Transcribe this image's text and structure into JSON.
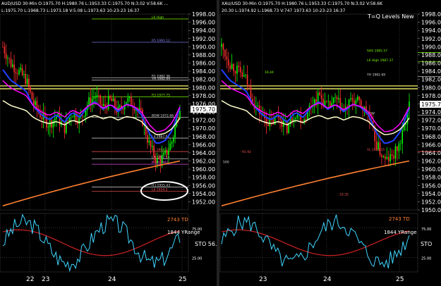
{
  "panels": [
    {
      "id": "left",
      "header": "AUD/USD 30-Min O:1975.70 H:1980.76 L:1953.33 C:1975.70 N:3.02 V:58.6K ...",
      "header2": "L:1975.70 L:1968.73 L:1973.18 V:5.08 L:1973.63 10-23-23 16:37",
      "last_price_tag": "1975.70",
      "level_labels": [
        {
          "text": "L6 High",
          "price": 1996.8,
          "color": "#7CFC00"
        },
        {
          "text": "R5 1991.12",
          "price": 1991.1,
          "color": "#8888ff"
        },
        {
          "text": "R1 1982.36",
          "price": 1982.4,
          "color": "#dddddd"
        },
        {
          "text": "YH 1982.69",
          "price": 1981.8,
          "color": "#dddddd"
        },
        {
          "text": "R3 1977.75",
          "price": 1977.7,
          "color": "#7CFC00"
        },
        {
          "text": "BOW 1972.68",
          "price": 1972.7,
          "color": "#dddddd"
        },
        {
          "text": "L3 1967.61",
          "price": 1967.6,
          "color": "#dddddd"
        },
        {
          "text": "YL 1964.25",
          "price": 1964.3,
          "color": "#ff5555"
        },
        {
          "text": "L4 1962.54",
          "price": 1962.5,
          "color": "#dddddd"
        },
        {
          "text": "M alt 1961",
          "price": 1961.2,
          "color": "#ff55ff"
        },
        {
          "text": "H.J 1955.43",
          "price": 1955.6,
          "color": "#dddddd"
        },
        {
          "text": "L6 1954.5",
          "price": 1954.6,
          "color": "#ff5555"
        }
      ],
      "stoch_labels": {
        "td": "2743 TD",
        "yrange": "1844 YRange",
        "sto": "STO 56."
      }
    },
    {
      "id": "right",
      "header": "XAU/USD 30-Min O:1975.70 H:1980.76 L:1953.33 C:1975.70 N:3.02 V:58.6K",
      "header2": "20.30 L:1974.92 L:1968.73 V:747 1973.63 10-23-23 16:37",
      "title": "T=Q Levels New",
      "last_price_tag": "1975.7",
      "level_labels": [
        {
          "text": "SHS 1985.57",
          "price": 1988.6,
          "color": "#7CFC00"
        },
        {
          "text": "L6 High 1987.37",
          "price": 1986.3,
          "color": "#7CFC00"
        },
        {
          "text": "YH 1982.69",
          "price": 1982.7,
          "color": "#dddddd"
        },
        {
          "text": "BOW",
          "price": 1973.2,
          "color": "#dddddd"
        },
        {
          "text": "YL 1964.25",
          "price": 1964.3,
          "color": "#ff5555"
        }
      ],
      "side_labels": [
        {
          "text": "16.44",
          "price": 1983.5,
          "color": "#7CFC00"
        },
        {
          "text": "- 91.92",
          "price": 1964.0,
          "color": "#ff5555"
        },
        {
          "text": "500",
          "price": 1961.5,
          "color": "#dddddd"
        },
        {
          "text": "- 33.35",
          "price": 1953.5,
          "color": "#ff5555"
        }
      ],
      "stoch_labels": {
        "td": "2743 TD",
        "yrange": "1844 YRange",
        "sto": "STO"
      }
    }
  ],
  "price_axis_ticks": [
    "1998.00",
    "1996.00",
    "1994.00",
    "1992.00",
    "1990.00",
    "1988.00",
    "1986.00",
    "1984.00",
    "1982.00",
    "1980.00",
    "1978.00",
    "1976.00",
    "1974.00",
    "1972.00",
    "1970.00",
    "1968.00",
    "1966.00",
    "1964.00",
    "1962.00",
    "1960.00",
    "1958.00",
    "1956.00",
    "1954.00",
    "1952.00"
  ],
  "price_axis_ticks_right": [
    "1998.0",
    "1996.0",
    "1994.0",
    "1992.0",
    "1990.0",
    "1988.0",
    "1986.0",
    "1984.0",
    "1982.0",
    "1980.0",
    "1978.0",
    "1976.0",
    "1974.0",
    "1972.0",
    "1970.0",
    "1968.0",
    "1966.0",
    "1964.0",
    "1962.0",
    "1960.0",
    "1958.0",
    "1956.0",
    "1954.0",
    "1952.0",
    "1950.0"
  ],
  "stoch_ticks": [
    "75.00",
    "25.00"
  ],
  "date_ticks_left": [
    "22",
    "23",
    "24",
    "25"
  ],
  "date_ticks_right": [
    "23",
    "24",
    "25"
  ],
  "colors": {
    "up": "#00ff00",
    "down": "#ff3030",
    "ema_blue": "#2040ff",
    "ema_mag": "#ff00ff",
    "ema_white": "#ffffcc",
    "ema_orange": "#ff8030",
    "yellow": "#e0e060",
    "stoch_cyan": "#3fd5ff",
    "stoch_red": "#c02020"
  },
  "chart_data": {
    "type": "line",
    "ylim": [
      1950,
      1998
    ],
    "close_series_approx": [
      1990,
      1986,
      1984,
      1982,
      1976,
      1973,
      1971,
      1973,
      1970,
      1974,
      1972,
      1976,
      1978,
      1975,
      1977,
      1974,
      1977,
      1976,
      1973,
      1966,
      1962,
      1963,
      1967,
      1975.7
    ],
    "series": [
      {
        "name": "2743 TD",
        "values": []
      },
      {
        "name": "1844 YRange",
        "values": []
      }
    ]
  }
}
